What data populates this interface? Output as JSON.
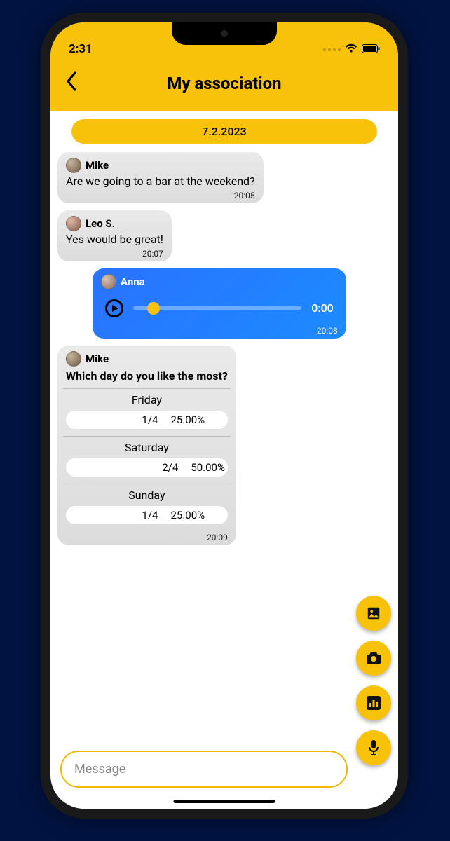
{
  "status": {
    "time": "2:31"
  },
  "header": {
    "title": "My association"
  },
  "date": "7.2.2023",
  "messages": [
    {
      "sender": "Mike",
      "text": "Are we going to a bar at the weekend?",
      "time": "20:05"
    },
    {
      "sender": "Leo S.",
      "text": "Yes would be great!",
      "time": "20:07"
    }
  ],
  "audio": {
    "sender": "Anna",
    "elapsed": "0:00",
    "time": "20:08"
  },
  "poll": {
    "sender": "Mike",
    "question": "Which day do you like the most?",
    "options": [
      {
        "label": "Friday",
        "count": "1/4",
        "pct": "25.00%",
        "fill": 25
      },
      {
        "label": "Saturday",
        "count": "2/4",
        "pct": "50.00%",
        "fill": 50
      },
      {
        "label": "Sunday",
        "count": "1/4",
        "pct": "25.00%",
        "fill": 25
      }
    ],
    "time": "20:09"
  },
  "input": {
    "placeholder": "Message"
  }
}
